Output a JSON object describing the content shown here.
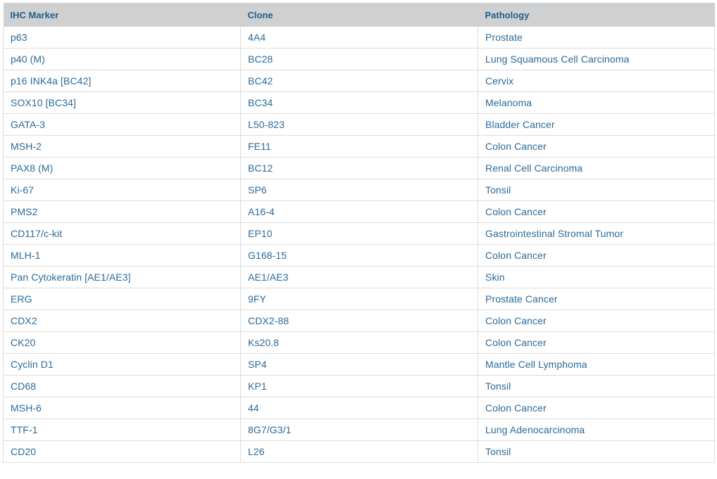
{
  "table": {
    "headers": {
      "marker": "IHC Marker",
      "clone": "Clone",
      "pathology": "Pathology"
    },
    "rows": [
      {
        "marker": "p63",
        "clone": "4A4",
        "pathology": "Prostate"
      },
      {
        "marker": "p40 (M)",
        "clone": "BC28",
        "pathology": "Lung Squamous Cell Carcinoma"
      },
      {
        "marker": "p16 INK4a [BC42]",
        "clone": "BC42",
        "pathology": "Cervix"
      },
      {
        "marker": "SOX10 [BC34]",
        "clone": "BC34",
        "pathology": "Melanoma"
      },
      {
        "marker": "GATA-3",
        "clone": "L50-823",
        "pathology": "Bladder Cancer"
      },
      {
        "marker": "MSH-2",
        "clone": "FE11",
        "pathology": "Colon Cancer"
      },
      {
        "marker": "PAX8 (M)",
        "clone": "BC12",
        "pathology": "Renal Cell Carcinoma"
      },
      {
        "marker": "Ki-67",
        "clone": "SP6",
        "pathology": "Tonsil"
      },
      {
        "marker": "PMS2",
        "clone": "A16-4",
        "pathology": "Colon Cancer"
      },
      {
        "marker": "CD117/c-kit",
        "clone": "EP10",
        "pathology": "Gastrointestinal Stromal Tumor"
      },
      {
        "marker": "MLH-1",
        "clone": "G168-15",
        "pathology": "Colon Cancer"
      },
      {
        "marker": "Pan Cytokeratin [AE1/AE3]",
        "clone": "AE1/AE3",
        "pathology": "Skin"
      },
      {
        "marker": "ERG",
        "clone": "9FY",
        "pathology": "Prostate Cancer"
      },
      {
        "marker": "CDX2",
        "clone": "CDX2-88",
        "pathology": "Colon Cancer"
      },
      {
        "marker": "CK20",
        "clone": "Ks20.8",
        "pathology": "Colon Cancer"
      },
      {
        "marker": "Cyclin D1",
        "clone": "SP4",
        "pathology": "Mantle Cell Lymphoma"
      },
      {
        "marker": "CD68",
        "clone": "KP1",
        "pathology": "Tonsil"
      },
      {
        "marker": "MSH-6",
        "clone": "44",
        "pathology": "Colon Cancer"
      },
      {
        "marker": "TTF-1",
        "clone": "8G7/G3/1",
        "pathology": "Lung Adenocarcinoma"
      },
      {
        "marker": "CD20",
        "clone": "L26",
        "pathology": "Tonsil"
      }
    ]
  },
  "colors": {
    "header_bg": "#cfd0d1",
    "header_text": "#1f5f8b",
    "cell_text": "#2a6a9a",
    "border": "#dcdcdc"
  }
}
